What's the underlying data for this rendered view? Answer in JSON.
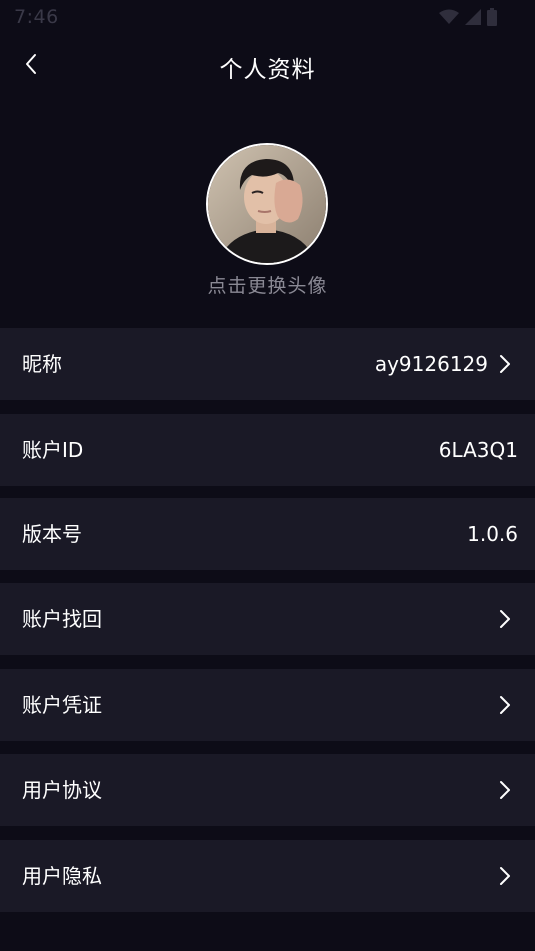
{
  "status_bar": {
    "time": "7:46",
    "icons": [
      "wifi-icon",
      "signal-icon",
      "battery-icon"
    ]
  },
  "header": {
    "title": "个人资料",
    "back_icon": "chevron-left-icon"
  },
  "profile": {
    "avatar_alt": "avatar",
    "change_avatar_hint": "点击更换头像"
  },
  "rows": [
    {
      "label": "昵称",
      "value": "ay9126129",
      "chevron": true
    },
    {
      "label": "账户ID",
      "value": "6LA3Q1",
      "chevron": false
    },
    {
      "label": "版本号",
      "value": "1.0.6",
      "chevron": false
    },
    {
      "label": "账户找回",
      "value": "",
      "chevron": true
    },
    {
      "label": "账户凭证",
      "value": "",
      "chevron": true
    },
    {
      "label": "用户协议",
      "value": "",
      "chevron": true
    },
    {
      "label": "用户隐私",
      "value": "",
      "chevron": true
    }
  ],
  "colors": {
    "background": "#0d0c17",
    "row_background": "#1a1926",
    "hint_text": "#8a8994"
  }
}
